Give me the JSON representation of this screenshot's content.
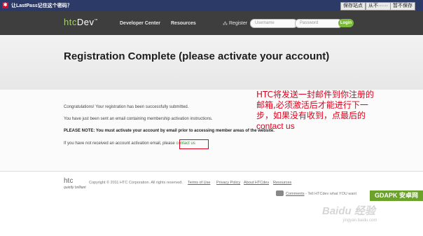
{
  "lastpass_bar": {
    "title": "让LastPass记住这个密码？",
    "buttons": [
      "保存站点",
      "从不······",
      "暂不保存"
    ]
  },
  "header": {
    "logo": {
      "htc": "htc",
      "dev": "Dev",
      "tm": "™"
    },
    "nav": [
      "Developer Center",
      "Resources"
    ],
    "register": "Register",
    "username_placeholder": "Username",
    "password_placeholder": "Password",
    "login": "Login"
  },
  "page_title": "Registration Complete (please activate your account)",
  "messages": {
    "congrats": "Congratulations! Your registration has been successfully submitted.",
    "email_sent": "You have just been sent an email containing membership activation instructions.",
    "note_label": "PLEASE NOTE:",
    "note_body": " You must activate your account by email prior to accessing member areas of the website.",
    "not_received": "If you have not received an account activation email, please ",
    "contact_link": "contact us"
  },
  "annotation": {
    "text_line1": "HTC将发送一封邮件到你注册的邮箱,必须激活后才能进行下一步，如果没有收到，点最后的",
    "text_line2": "contact us"
  },
  "footer": {
    "logo": "htc",
    "tagline": "quietly brilliant",
    "copyright": "Copyright © 2011 HTC Corporation. All rights reserved.",
    "links": [
      "Terms of Use",
      "Privacy Policy",
      "About HTCdev",
      "Resources"
    ],
    "comments_link": "Comments",
    "comments_text": " - Tell HTCdev what YOU want"
  },
  "watermarks": {
    "site": "GDAPK 安卓网",
    "baidu": "Baidu 经验",
    "url": "jingyan.baidu.com"
  }
}
